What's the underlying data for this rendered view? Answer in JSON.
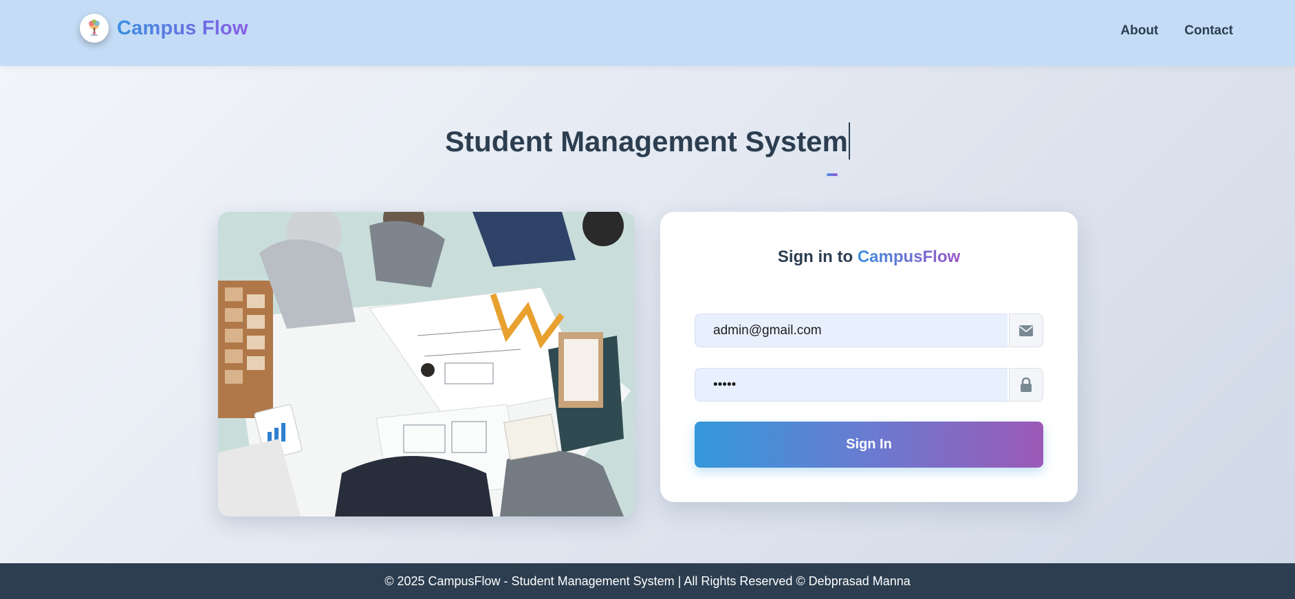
{
  "header": {
    "brand": "Campus Flow",
    "nav": [
      {
        "label": "About"
      },
      {
        "label": "Contact"
      }
    ]
  },
  "hero": {
    "title": "Student Management System"
  },
  "login": {
    "heading_prefix": "Sign in to ",
    "heading_brand": "CampusFlow",
    "email_value": "admin@gmail.com",
    "password_value": "•••••",
    "email_icon": "envelope-icon",
    "password_icon": "lock-icon",
    "submit_label": "Sign In"
  },
  "footer": {
    "text": "© 2025 CampusFlow - Student Management System | All Rights Reserved © Debprasad Manna"
  },
  "colors": {
    "navbar": "#c4dcf5",
    "primary_text": "#2c3e50",
    "gradient_start": "#3498db",
    "gradient_end": "#9b59b6",
    "input_bg": "#e8f0fe",
    "footer_bg": "#2c3e50"
  }
}
